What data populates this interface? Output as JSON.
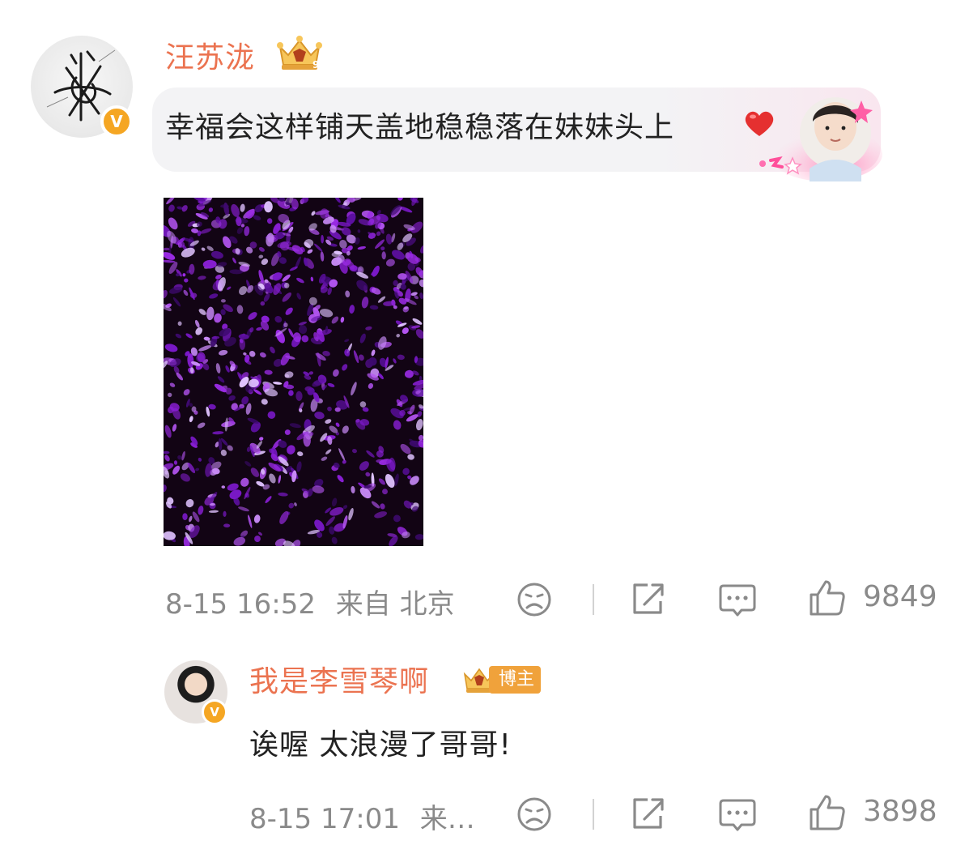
{
  "comment": {
    "username": "汪苏泷",
    "text": "幸福会这样铺天盖地稳稳落在妹妹头上",
    "badge_icon": "verified-v-badge",
    "vip_icon": "crown-level-icon",
    "timestamp": "8-15 16:52",
    "location": "来自 北京",
    "like_count": "9849"
  },
  "reply": {
    "username": "我是李雪琴啊",
    "role_badge": "博主",
    "text": "诶喔 太浪漫了哥哥!",
    "timestamp": "8-15 17:01",
    "location": "来…",
    "like_count": "3898"
  },
  "colors": {
    "username": "#eb7350",
    "verified": "#f5a623",
    "meta_text": "#8a8a8a",
    "bubble_bg": "#f3f3f5",
    "photo_purple": "#8a1fd6"
  },
  "icons": [
    "sad-face-icon",
    "share-icon",
    "comment-icon",
    "like-thumb-icon",
    "heart-icon"
  ]
}
